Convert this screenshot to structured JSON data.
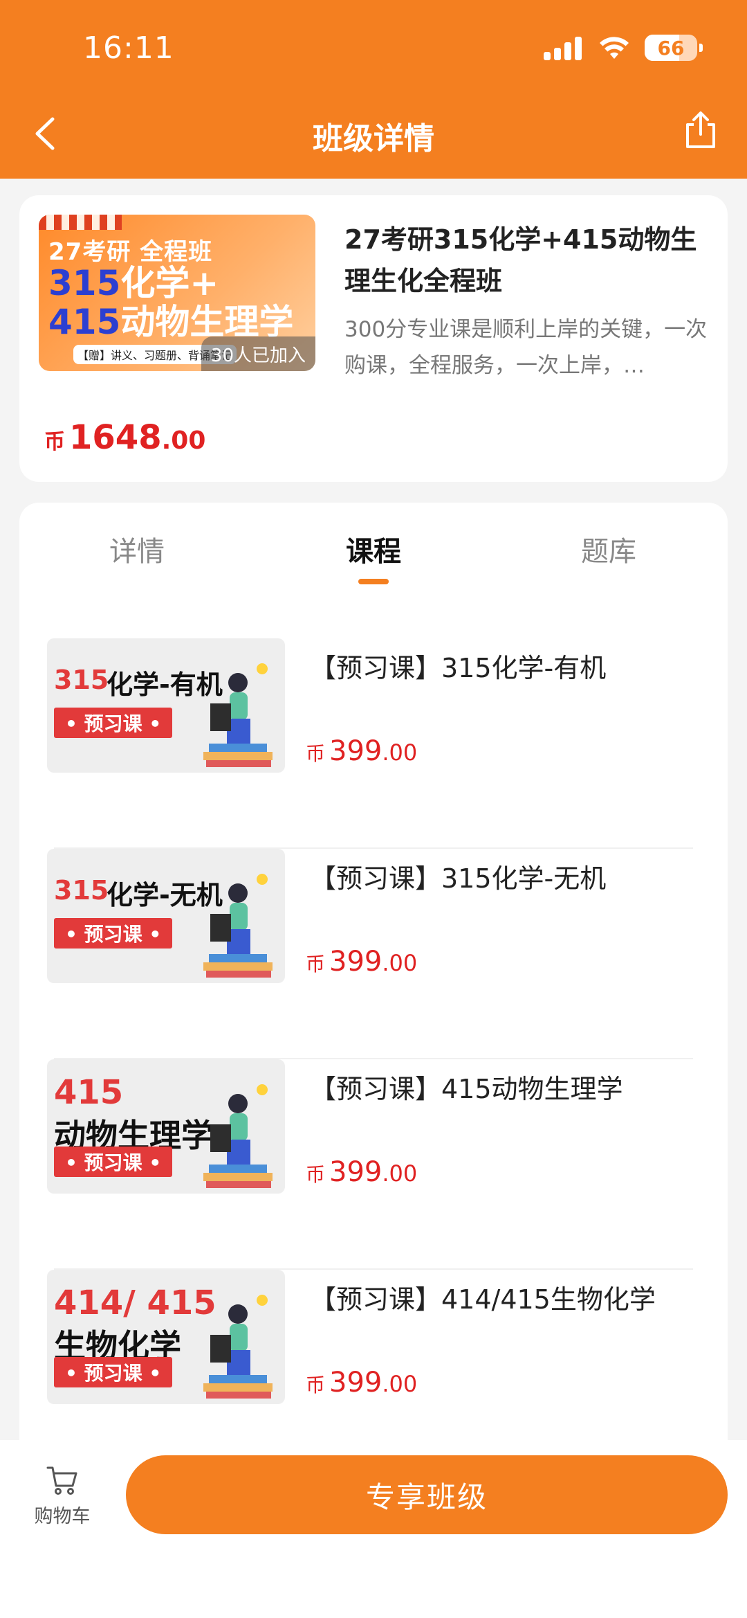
{
  "status_bar": {
    "time": "16:11",
    "battery": "66"
  },
  "header": {
    "title": "班级详情"
  },
  "class_info": {
    "cover_line1": "27考研 全程班",
    "cover_num1": "315",
    "cover_text1": "化学+",
    "cover_num2": "415",
    "cover_text2": "动物生理学",
    "cover_gift": "【赠】讲义、习题册、背诵笔记",
    "joined": "30人已加入",
    "title": "27考研315化学+415动物生理生化全程班",
    "description": "300分专业课是顺利上岸的关键，一次购课，全程服务，一次上岸，…",
    "price_currency": "币",
    "price_int": "1648",
    "price_dec": ".00"
  },
  "tabs": [
    {
      "label": "详情"
    },
    {
      "label": "课程"
    },
    {
      "label": "题库"
    }
  ],
  "courses": [
    {
      "thumb_num": "315",
      "thumb_name": "化学-有机",
      "thumb_badge": "• 预习课 •",
      "title": "【预习课】315化学-有机",
      "price_currency": "币",
      "price_int": "399",
      "price_dec": ".00"
    },
    {
      "thumb_num": "315",
      "thumb_name": "化学-无机",
      "thumb_badge": "• 预习课 •",
      "title": "【预习课】315化学-无机",
      "price_currency": "币",
      "price_int": "399",
      "price_dec": ".00"
    },
    {
      "thumb_num": "415",
      "thumb_name": "动物生理学",
      "thumb_badge": "• 预习课 •",
      "title": "【预习课】415动物生理学",
      "price_currency": "币",
      "price_int": "399",
      "price_dec": ".00"
    },
    {
      "thumb_num": "414/ 415",
      "thumb_name": "生物化学",
      "thumb_badge": "• 预习课 •",
      "title": "【预习课】414/415生物化学",
      "price_currency": "币",
      "price_int": "399",
      "price_dec": ".00"
    }
  ],
  "bottom_bar": {
    "cart_label": "购物车",
    "cta_label": "专享班级"
  },
  "colors": {
    "brand": "#f47f20",
    "price": "#e02222"
  }
}
